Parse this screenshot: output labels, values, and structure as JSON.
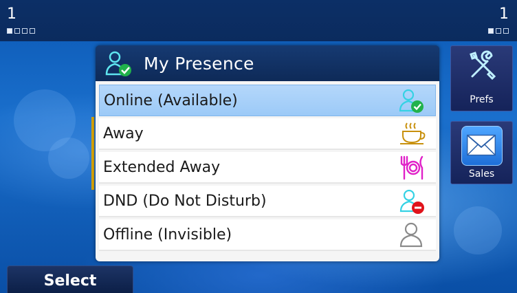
{
  "status": {
    "left_line": "1",
    "right_line": "1"
  },
  "popup": {
    "title": "My Presence",
    "title_icon": "presence-online-icon",
    "items": [
      {
        "label": "Online (Available)",
        "icon": "user-online-check-icon",
        "selected": true
      },
      {
        "label": "Away",
        "icon": "coffee-cup-icon",
        "selected": false
      },
      {
        "label": "Extended Away",
        "icon": "fork-plate-knife-icon",
        "selected": false
      },
      {
        "label": "DND (Do Not Disturb)",
        "icon": "user-dnd-icon",
        "selected": false
      },
      {
        "label": "Offline (Invisible)",
        "icon": "user-offline-icon",
        "selected": false
      }
    ]
  },
  "side_buttons": {
    "prefs_label": "Prefs",
    "sales_label": "Sales"
  },
  "softkeys": {
    "select_label": "Select"
  },
  "colors": {
    "selected_row": "#a8d0f9",
    "accent_green": "#21b24b",
    "dnd_red": "#e0131b",
    "focus_bar": "#d9a400"
  }
}
